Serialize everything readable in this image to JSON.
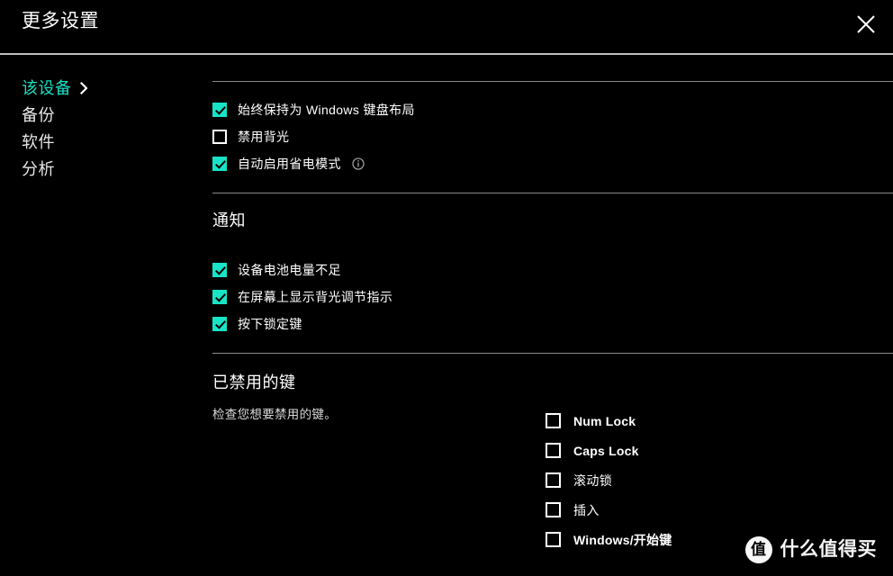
{
  "window": {
    "title": "更多设置",
    "close_icon": "close-icon",
    "accent_color": "#19e3c6",
    "background_color": "#000000",
    "divider_color": "#8a8a8a"
  },
  "sidebar": {
    "items": [
      {
        "label": "该设备",
        "active": true,
        "chevron": "chevron-right-icon"
      },
      {
        "label": "备份",
        "active": false
      },
      {
        "label": "软件",
        "active": false
      },
      {
        "label": "分析",
        "active": false
      }
    ]
  },
  "main": {
    "device_options": [
      {
        "label": "始终保持为 Windows 键盘布局",
        "checked": true,
        "info": false
      },
      {
        "label": "禁用背光",
        "checked": false,
        "info": false
      },
      {
        "label": "自动启用省电模式",
        "checked": true,
        "info": true,
        "info_icon": "info-icon"
      }
    ],
    "notifications": {
      "heading": "通知",
      "options": [
        {
          "label": "设备电池电量不足",
          "checked": true
        },
        {
          "label": "在屏幕上显示背光调节指示",
          "checked": true
        },
        {
          "label": "按下锁定键",
          "checked": true
        }
      ]
    },
    "disabled_keys": {
      "heading": "已禁用的键",
      "description": "检查您想要禁用的键。",
      "keys": [
        {
          "label": "Num Lock",
          "checked": false,
          "latin": true
        },
        {
          "label": "Caps Lock",
          "checked": false,
          "latin": true
        },
        {
          "label": "滚动锁",
          "checked": false,
          "latin": false
        },
        {
          "label": "插入",
          "checked": false,
          "latin": false
        },
        {
          "label": "Windows/开始键",
          "checked": false,
          "latin": true
        }
      ]
    }
  },
  "watermark": {
    "badge": "值",
    "text": "什么值得买"
  }
}
